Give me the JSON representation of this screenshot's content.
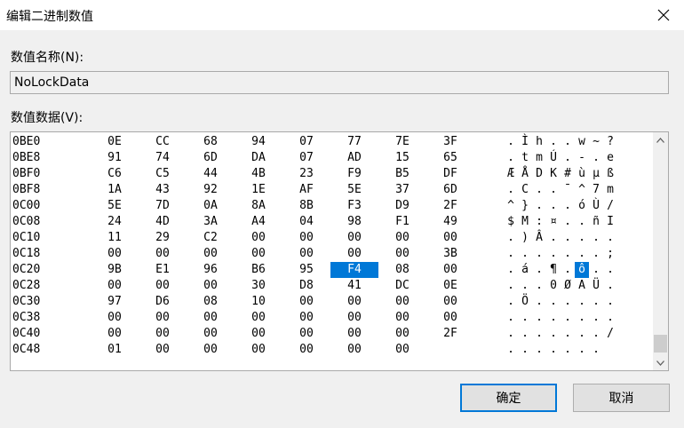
{
  "window": {
    "title": "编辑二进制数值"
  },
  "value_name": {
    "label": "数值名称(N):",
    "value": "NoLockData"
  },
  "value_data": {
    "label": "数值数据(V):",
    "rows": [
      {
        "addr": "0BE0",
        "bytes": [
          "0E",
          "CC",
          "68",
          "94",
          "07",
          "77",
          "7E",
          "3F"
        ],
        "ascii": [
          ".",
          "Ì",
          "h",
          ".",
          ".",
          "w",
          "~",
          "?"
        ]
      },
      {
        "addr": "0BE8",
        "bytes": [
          "91",
          "74",
          "6D",
          "DA",
          "07",
          "AD",
          "15",
          "65"
        ],
        "ascii": [
          ".",
          "t",
          "m",
          "Ú",
          ".",
          "-",
          ".",
          "e"
        ]
      },
      {
        "addr": "0BF0",
        "bytes": [
          "C6",
          "C5",
          "44",
          "4B",
          "23",
          "F9",
          "B5",
          "DF"
        ],
        "ascii": [
          "Æ",
          "Å",
          "D",
          "K",
          "#",
          "ù",
          "µ",
          "ß"
        ]
      },
      {
        "addr": "0BF8",
        "bytes": [
          "1A",
          "43",
          "92",
          "1E",
          "AF",
          "5E",
          "37",
          "6D"
        ],
        "ascii": [
          ".",
          "C",
          ".",
          ".",
          "¯",
          "^",
          "7",
          "m"
        ]
      },
      {
        "addr": "0C00",
        "bytes": [
          "5E",
          "7D",
          "0A",
          "8A",
          "8B",
          "F3",
          "D9",
          "2F"
        ],
        "ascii": [
          "^",
          "}",
          ".",
          ".",
          ".",
          "ó",
          "Ù",
          "/"
        ]
      },
      {
        "addr": "0C08",
        "bytes": [
          "24",
          "4D",
          "3A",
          "A4",
          "04",
          "98",
          "F1",
          "49"
        ],
        "ascii": [
          "$",
          "M",
          ":",
          "¤",
          ".",
          ".",
          "ñ",
          "I"
        ]
      },
      {
        "addr": "0C10",
        "bytes": [
          "11",
          "29",
          "C2",
          "00",
          "00",
          "00",
          "00",
          "00"
        ],
        "ascii": [
          ".",
          ")",
          "Â",
          ".",
          ".",
          ".",
          ".",
          "."
        ]
      },
      {
        "addr": "0C18",
        "bytes": [
          "00",
          "00",
          "00",
          "00",
          "00",
          "00",
          "00",
          "3B"
        ],
        "ascii": [
          ".",
          ".",
          ".",
          ".",
          ".",
          ".",
          ".",
          ";"
        ]
      },
      {
        "addr": "0C20",
        "bytes": [
          "9B",
          "E1",
          "96",
          "B6",
          "95",
          "F4",
          "08",
          "00"
        ],
        "ascii": [
          ".",
          "á",
          ".",
          "¶",
          ".",
          "ô",
          ".",
          "."
        ]
      },
      {
        "addr": "0C28",
        "bytes": [
          "00",
          "00",
          "00",
          "30",
          "D8",
          "41",
          "DC",
          "0E"
        ],
        "ascii": [
          ".",
          ".",
          ".",
          "0",
          "Ø",
          "A",
          "Ü",
          "."
        ]
      },
      {
        "addr": "0C30",
        "bytes": [
          "97",
          "D6",
          "08",
          "10",
          "00",
          "00",
          "00",
          "00"
        ],
        "ascii": [
          ".",
          "Ö",
          ".",
          ".",
          ".",
          ".",
          ".",
          "."
        ]
      },
      {
        "addr": "0C38",
        "bytes": [
          "00",
          "00",
          "00",
          "00",
          "00",
          "00",
          "00",
          "00"
        ],
        "ascii": [
          ".",
          ".",
          ".",
          ".",
          ".",
          ".",
          ".",
          "."
        ]
      },
      {
        "addr": "0C40",
        "bytes": [
          "00",
          "00",
          "00",
          "00",
          "00",
          "00",
          "00",
          "2F"
        ],
        "ascii": [
          ".",
          ".",
          ".",
          ".",
          ".",
          ".",
          ".",
          "/"
        ]
      },
      {
        "addr": "0C48",
        "bytes": [
          "01",
          "00",
          "00",
          "00",
          "00",
          "00",
          "00"
        ],
        "ascii": [
          ".",
          ".",
          ".",
          ".",
          ".",
          ".",
          "."
        ]
      }
    ],
    "selected": {
      "row": 8,
      "col": 5
    }
  },
  "buttons": {
    "ok": "确定",
    "cancel": "取消"
  },
  "icons": {
    "close": "close-icon",
    "scroll_up": "chevron-up-icon",
    "scroll_down": "chevron-down-icon"
  },
  "colors": {
    "selection": "#0078d7",
    "default_button_border": "#0078d7"
  }
}
